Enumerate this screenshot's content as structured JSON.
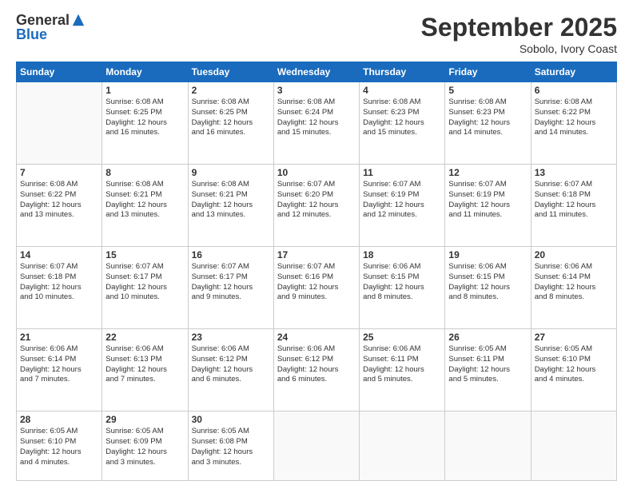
{
  "header": {
    "logo_general": "General",
    "logo_blue": "Blue",
    "month": "September 2025",
    "location": "Sobolo, Ivory Coast"
  },
  "weekdays": [
    "Sunday",
    "Monday",
    "Tuesday",
    "Wednesday",
    "Thursday",
    "Friday",
    "Saturday"
  ],
  "weeks": [
    [
      {
        "day": "",
        "info": ""
      },
      {
        "day": "1",
        "info": "Sunrise: 6:08 AM\nSunset: 6:25 PM\nDaylight: 12 hours\nand 16 minutes."
      },
      {
        "day": "2",
        "info": "Sunrise: 6:08 AM\nSunset: 6:25 PM\nDaylight: 12 hours\nand 16 minutes."
      },
      {
        "day": "3",
        "info": "Sunrise: 6:08 AM\nSunset: 6:24 PM\nDaylight: 12 hours\nand 15 minutes."
      },
      {
        "day": "4",
        "info": "Sunrise: 6:08 AM\nSunset: 6:23 PM\nDaylight: 12 hours\nand 15 minutes."
      },
      {
        "day": "5",
        "info": "Sunrise: 6:08 AM\nSunset: 6:23 PM\nDaylight: 12 hours\nand 14 minutes."
      },
      {
        "day": "6",
        "info": "Sunrise: 6:08 AM\nSunset: 6:22 PM\nDaylight: 12 hours\nand 14 minutes."
      }
    ],
    [
      {
        "day": "7",
        "info": "Sunrise: 6:08 AM\nSunset: 6:22 PM\nDaylight: 12 hours\nand 13 minutes."
      },
      {
        "day": "8",
        "info": "Sunrise: 6:08 AM\nSunset: 6:21 PM\nDaylight: 12 hours\nand 13 minutes."
      },
      {
        "day": "9",
        "info": "Sunrise: 6:08 AM\nSunset: 6:21 PM\nDaylight: 12 hours\nand 13 minutes."
      },
      {
        "day": "10",
        "info": "Sunrise: 6:07 AM\nSunset: 6:20 PM\nDaylight: 12 hours\nand 12 minutes."
      },
      {
        "day": "11",
        "info": "Sunrise: 6:07 AM\nSunset: 6:19 PM\nDaylight: 12 hours\nand 12 minutes."
      },
      {
        "day": "12",
        "info": "Sunrise: 6:07 AM\nSunset: 6:19 PM\nDaylight: 12 hours\nand 11 minutes."
      },
      {
        "day": "13",
        "info": "Sunrise: 6:07 AM\nSunset: 6:18 PM\nDaylight: 12 hours\nand 11 minutes."
      }
    ],
    [
      {
        "day": "14",
        "info": "Sunrise: 6:07 AM\nSunset: 6:18 PM\nDaylight: 12 hours\nand 10 minutes."
      },
      {
        "day": "15",
        "info": "Sunrise: 6:07 AM\nSunset: 6:17 PM\nDaylight: 12 hours\nand 10 minutes."
      },
      {
        "day": "16",
        "info": "Sunrise: 6:07 AM\nSunset: 6:17 PM\nDaylight: 12 hours\nand 9 minutes."
      },
      {
        "day": "17",
        "info": "Sunrise: 6:07 AM\nSunset: 6:16 PM\nDaylight: 12 hours\nand 9 minutes."
      },
      {
        "day": "18",
        "info": "Sunrise: 6:06 AM\nSunset: 6:15 PM\nDaylight: 12 hours\nand 8 minutes."
      },
      {
        "day": "19",
        "info": "Sunrise: 6:06 AM\nSunset: 6:15 PM\nDaylight: 12 hours\nand 8 minutes."
      },
      {
        "day": "20",
        "info": "Sunrise: 6:06 AM\nSunset: 6:14 PM\nDaylight: 12 hours\nand 8 minutes."
      }
    ],
    [
      {
        "day": "21",
        "info": "Sunrise: 6:06 AM\nSunset: 6:14 PM\nDaylight: 12 hours\nand 7 minutes."
      },
      {
        "day": "22",
        "info": "Sunrise: 6:06 AM\nSunset: 6:13 PM\nDaylight: 12 hours\nand 7 minutes."
      },
      {
        "day": "23",
        "info": "Sunrise: 6:06 AM\nSunset: 6:12 PM\nDaylight: 12 hours\nand 6 minutes."
      },
      {
        "day": "24",
        "info": "Sunrise: 6:06 AM\nSunset: 6:12 PM\nDaylight: 12 hours\nand 6 minutes."
      },
      {
        "day": "25",
        "info": "Sunrise: 6:06 AM\nSunset: 6:11 PM\nDaylight: 12 hours\nand 5 minutes."
      },
      {
        "day": "26",
        "info": "Sunrise: 6:05 AM\nSunset: 6:11 PM\nDaylight: 12 hours\nand 5 minutes."
      },
      {
        "day": "27",
        "info": "Sunrise: 6:05 AM\nSunset: 6:10 PM\nDaylight: 12 hours\nand 4 minutes."
      }
    ],
    [
      {
        "day": "28",
        "info": "Sunrise: 6:05 AM\nSunset: 6:10 PM\nDaylight: 12 hours\nand 4 minutes."
      },
      {
        "day": "29",
        "info": "Sunrise: 6:05 AM\nSunset: 6:09 PM\nDaylight: 12 hours\nand 3 minutes."
      },
      {
        "day": "30",
        "info": "Sunrise: 6:05 AM\nSunset: 6:08 PM\nDaylight: 12 hours\nand 3 minutes."
      },
      {
        "day": "",
        "info": ""
      },
      {
        "day": "",
        "info": ""
      },
      {
        "day": "",
        "info": ""
      },
      {
        "day": "",
        "info": ""
      }
    ]
  ]
}
